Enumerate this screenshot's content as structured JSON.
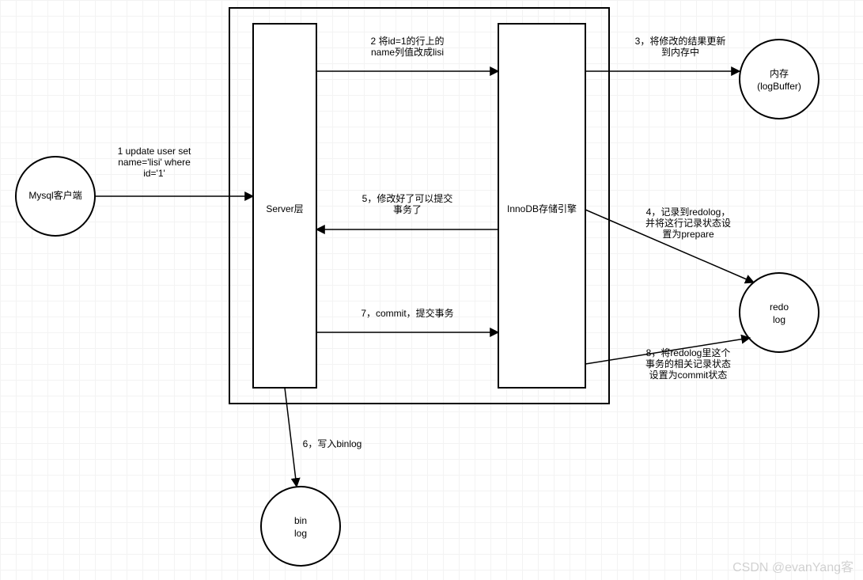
{
  "nodes": {
    "client": {
      "label": "Mysql客户端"
    },
    "server": {
      "label": "Server层"
    },
    "innodb": {
      "label": "InnoDB存储引擎"
    },
    "memory": {
      "line1": "内存",
      "line2": "(logBuffer)"
    },
    "redolog": {
      "line1": "redo",
      "line2": "log"
    },
    "binlog": {
      "line1": "bin",
      "line2": "log"
    }
  },
  "arrows": {
    "a1": {
      "line1": "1 update user set",
      "line2": "name='lisi' where",
      "line3": "id='1'"
    },
    "a2": {
      "line1": "2 将id=1的行上的",
      "line2": "name列值改成lisi"
    },
    "a3": {
      "line1": "3，将修改的结果更新",
      "line2": "到内存中"
    },
    "a4": {
      "line1": "4，记录到redolog，",
      "line2": "并将这行记录状态设",
      "line3": "置为prepare"
    },
    "a5": {
      "line1": "5，修改好了可以提交",
      "line2": "事务了"
    },
    "a6": {
      "line1": "6，写入binlog"
    },
    "a7": {
      "line1": "7，commit，提交事务"
    },
    "a8": {
      "line1": "8，将redolog里这个",
      "line2": "事务的相关记录状态",
      "line3": "设置为commit状态"
    }
  },
  "watermark": "CSDN @evanYang客"
}
